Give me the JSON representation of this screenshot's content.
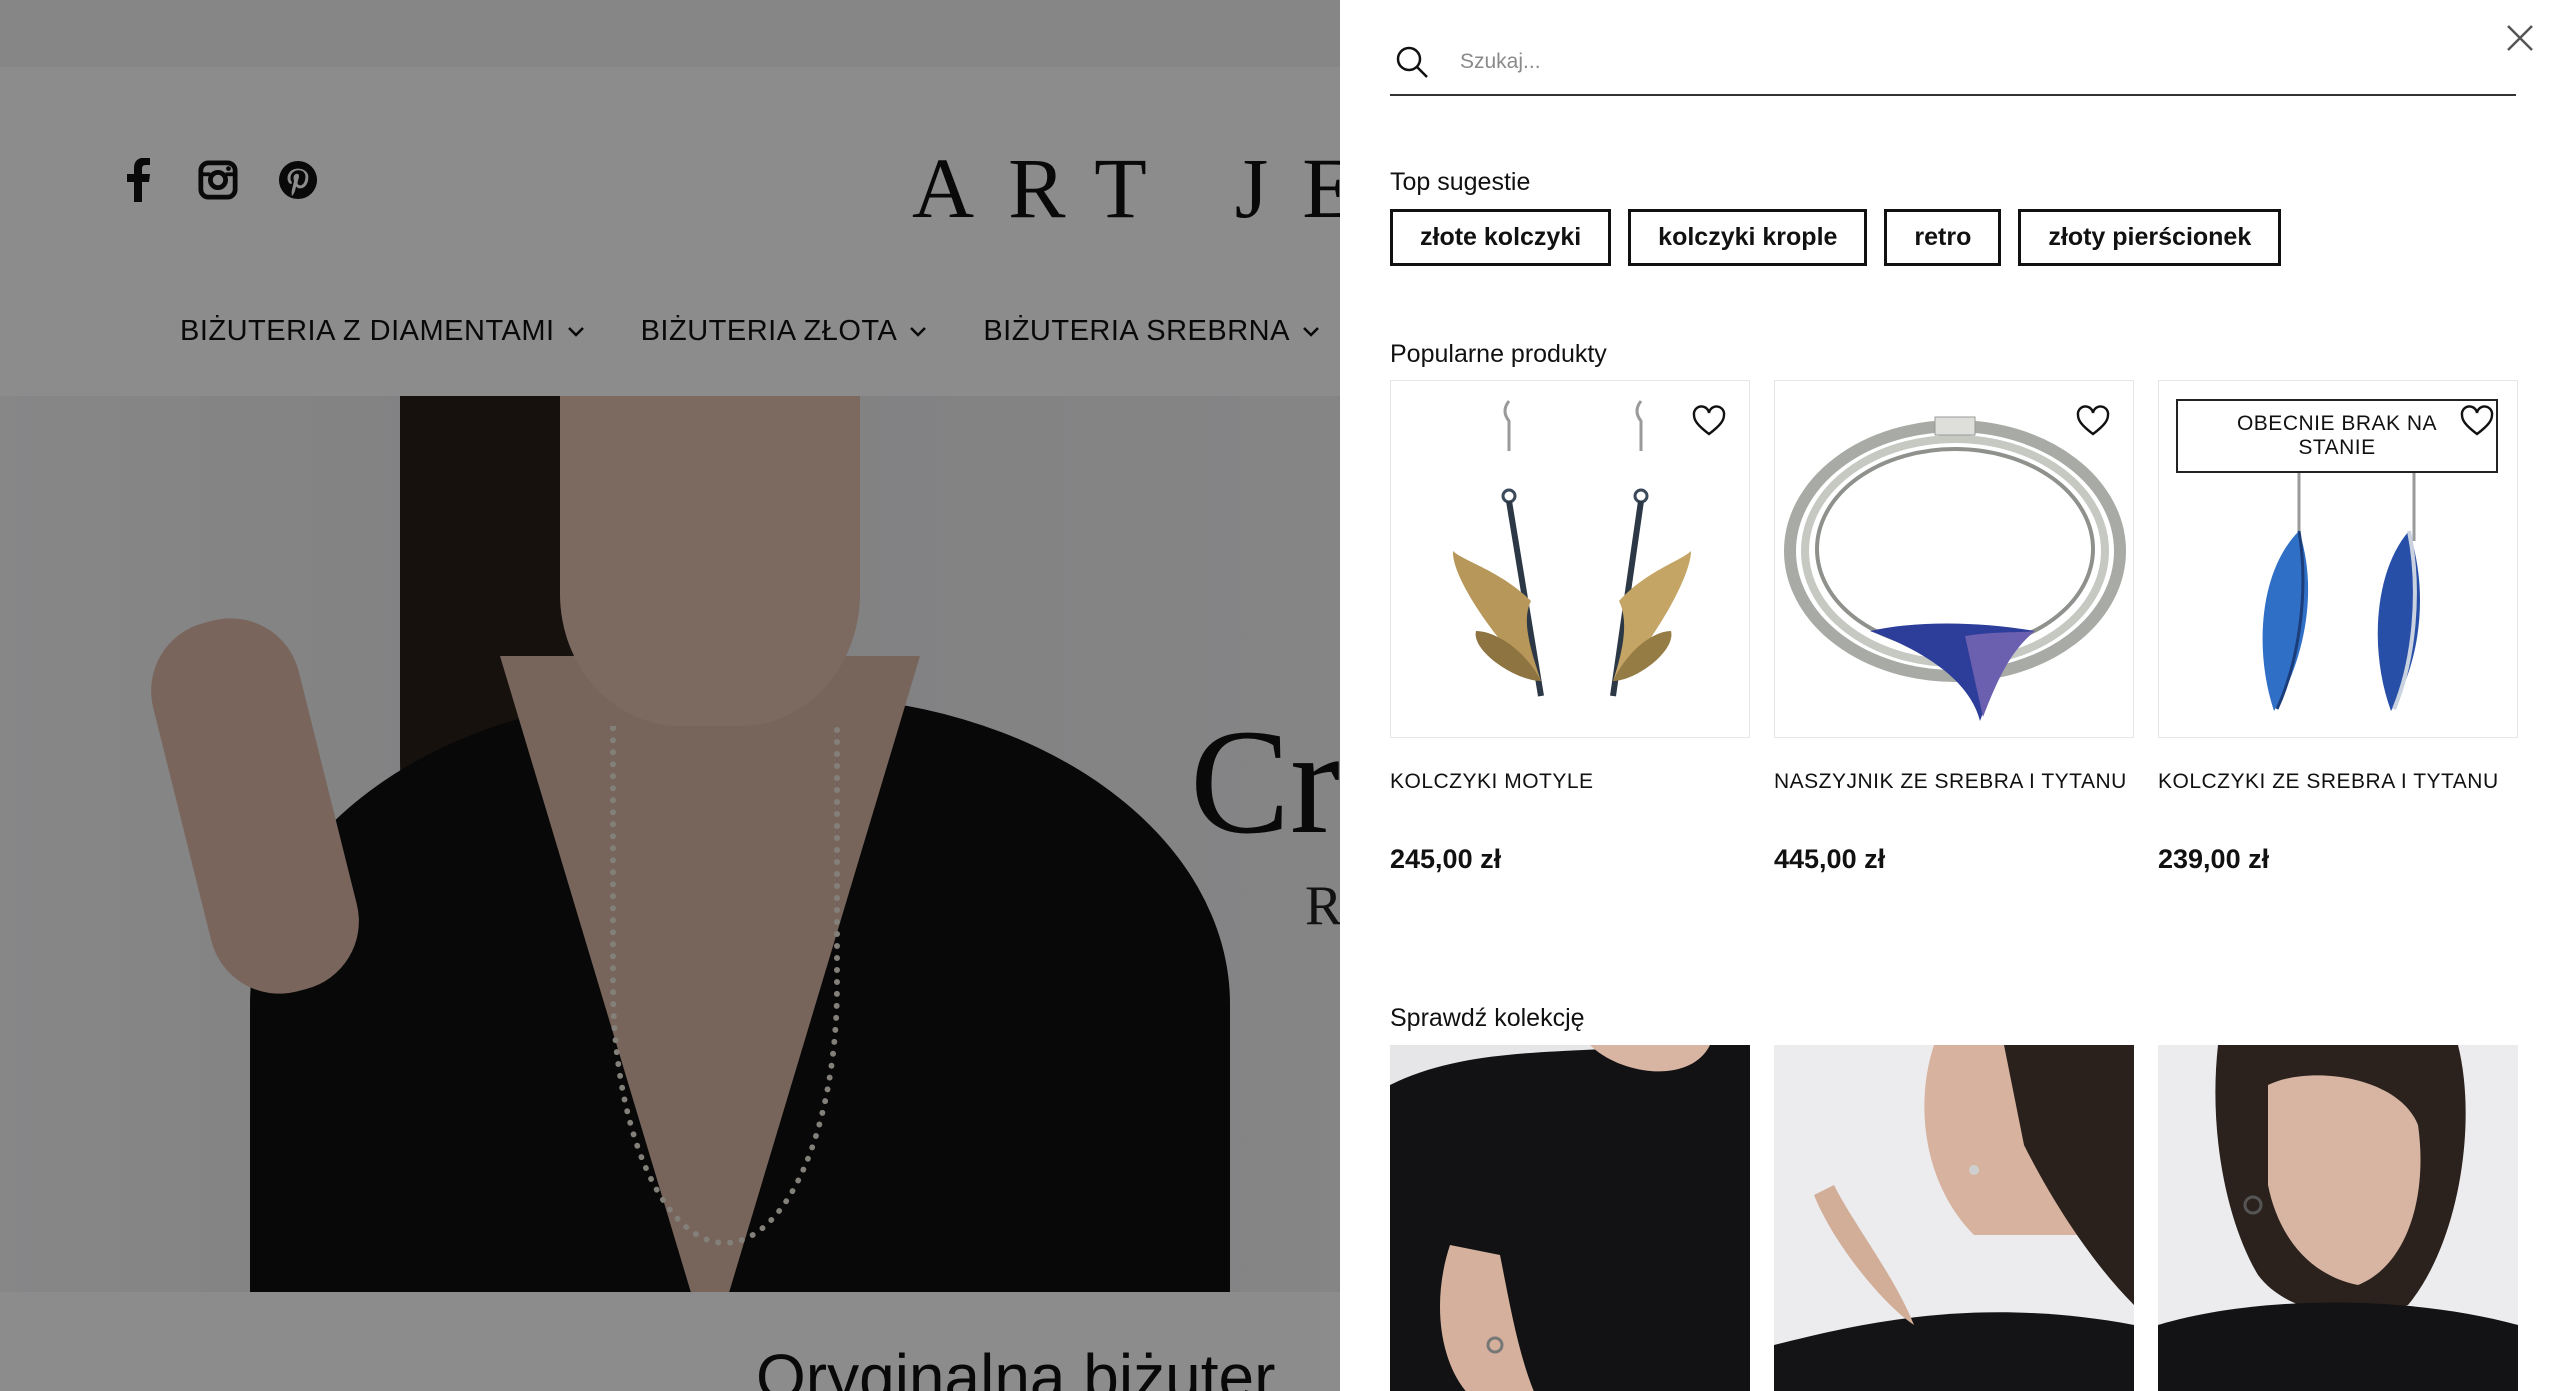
{
  "background_page": {
    "logo_text": "ART JE",
    "social": [
      "facebook-icon",
      "instagram-icon",
      "pinterest-icon"
    ],
    "nav": [
      {
        "label": "BIŻUTERIA Z DIAMENTAMI"
      },
      {
        "label": "BIŻUTERIA ZŁOTA"
      },
      {
        "label": "BIŻUTERIA SREBRNA"
      }
    ],
    "hero_text_large": "Cr",
    "hero_text_small": "Re",
    "bottom_heading": "Oryginalna biżuter"
  },
  "search_panel": {
    "placeholder": "Szukaj...",
    "top_suggestions_title": "Top sugestie",
    "suggestions": [
      "złote kolczyki",
      "kolczyki krople",
      "retro",
      "złoty pierścionek"
    ],
    "popular_title": "Popularne produkty",
    "products": [
      {
        "name": "KOLCZYKI MOTYLE",
        "price": "245,00 zł",
        "badge": ""
      },
      {
        "name": "NASZYJNIK ZE SREBRA I TYTANU",
        "price": "445,00 zł",
        "badge": ""
      },
      {
        "name": "KOLCZYKI ZE SREBRA I TYTANU",
        "price": "239,00 zł",
        "badge": "OBECNIE BRAK NA STANIE"
      }
    ],
    "collections_title": "Sprawdź kolekcję"
  },
  "colors": {
    "overlay": "#000000",
    "text": "#111111",
    "titanium_blue": "#2f6fc6"
  }
}
